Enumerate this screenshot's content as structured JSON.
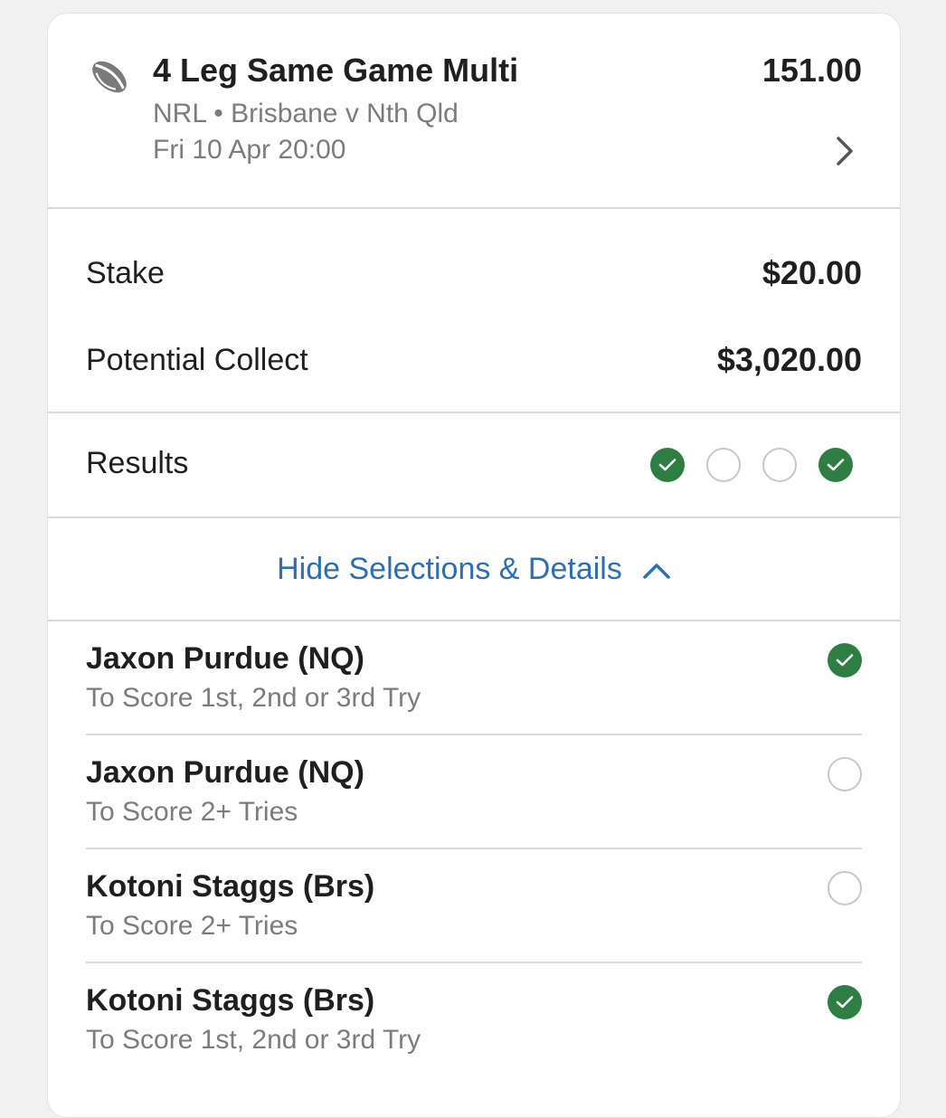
{
  "bet": {
    "title": "4 Leg Same Game Multi",
    "odds": "151.00",
    "event": "NRL • Brisbane v Nth Qld",
    "datetime": "Fri 10 Apr 20:00",
    "sport_icon": "rugby-ball-icon"
  },
  "stake": {
    "label": "Stake",
    "value": "$20.00"
  },
  "collect": {
    "label": "Potential Collect",
    "value": "$3,020.00"
  },
  "results": {
    "label": "Results",
    "statuses": [
      "won",
      "pending",
      "pending",
      "won"
    ]
  },
  "toggle": {
    "label": "Hide Selections & Details"
  },
  "selections": [
    {
      "name": "Jaxon Purdue (NQ)",
      "market": "To Score 1st, 2nd or 3rd Try",
      "status": "won"
    },
    {
      "name": "Jaxon Purdue (NQ)",
      "market": "To Score 2+ Tries",
      "status": "pending"
    },
    {
      "name": "Kotoni Staggs (Brs)",
      "market": "To Score 2+ Tries",
      "status": "pending"
    },
    {
      "name": "Kotoni Staggs (Brs)",
      "market": "To Score 1st, 2nd or 3rd Try",
      "status": "won"
    }
  ],
  "colors": {
    "won": "#2e7d42",
    "link": "#2d6fb6",
    "muted": "#7c7c7c"
  }
}
